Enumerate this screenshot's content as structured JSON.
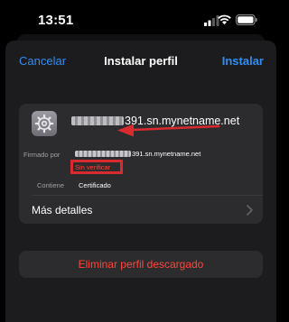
{
  "status_bar": {
    "time": "13:51"
  },
  "nav": {
    "cancel_label": "Cancelar",
    "title": "Instalar perfil",
    "install_label": "Instalar"
  },
  "profile": {
    "name": "391.sn.mynetname.net",
    "signed_by_label": "Firmado por",
    "signed_by_value": "391.sn.mynetname.net",
    "verification_status": "Sin verificar",
    "contains_label": "Contiene",
    "contains_value": "Certificado",
    "more_details_label": "Más detalles"
  },
  "actions": {
    "delete_label": "Eliminar perfil descargado"
  },
  "icons": {
    "settings": "gear-icon",
    "signal": "cellular-signal-icon",
    "wifi": "wifi-icon",
    "battery": "battery-icon",
    "chevron": "chevron-right-icon",
    "annotation": "red-arrow-annotation"
  },
  "colors": {
    "accent": "#2f8ef3",
    "destructive": "#ff453a",
    "annotation_red": "#d82a2f",
    "sheet_bg": "#1c1c1e",
    "card_bg": "#2c2c2e"
  }
}
